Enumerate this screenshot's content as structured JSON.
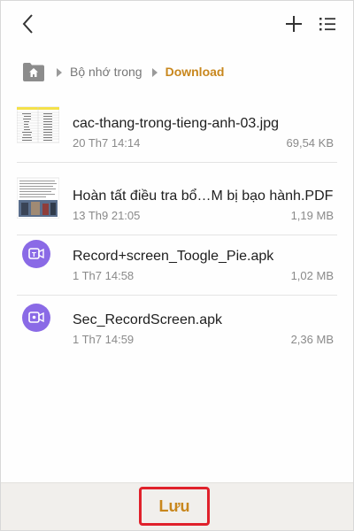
{
  "header": {
    "back_icon": "back-arrow-icon",
    "add_icon": "plus-icon",
    "view_icon": "list-view-icon"
  },
  "breadcrumb": {
    "home_icon": "home-folder-icon",
    "items": [
      {
        "label": "Bộ nhớ trong"
      },
      {
        "label": "Download"
      }
    ],
    "current_color": "#c8871d"
  },
  "files": [
    {
      "name": "cac-thang-trong-tieng-anh-03.jpg",
      "date": "20 Th7 14:14",
      "size": "69,54 KB",
      "icon": "spreadsheet-image-thumbnail"
    },
    {
      "name": "Hoàn tất điều tra bổ…M bị bạo hành.PDF",
      "date": "13 Th9 21:05",
      "size": "1,19 MB",
      "icon": "pdf-document-thumbnail"
    },
    {
      "name": "Record+screen_Toogle_Pie.apk",
      "date": "1 Th7 14:58",
      "size": "1,02 MB",
      "icon": "screen-recorder-app-icon"
    },
    {
      "name": "Sec_RecordScreen.apk",
      "date": "1 Th7 14:59",
      "size": "2,36 MB",
      "icon": "screen-recorder-app-icon"
    }
  ],
  "footer": {
    "save_label": "Lưu",
    "highlight_color": "#e0212b"
  },
  "colors": {
    "accent": "#c8871d",
    "apk_icon": "#8a6ae6"
  }
}
